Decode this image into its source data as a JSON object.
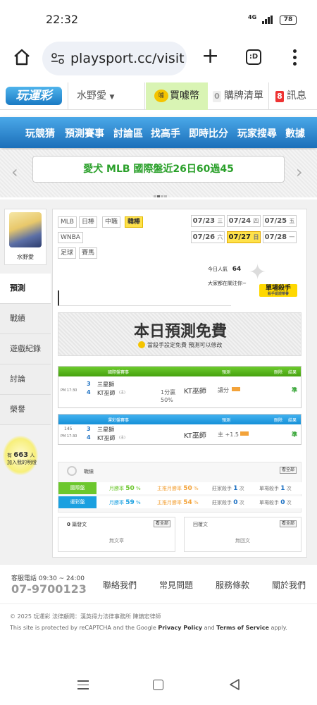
{
  "status_bar": {
    "time": "22:32",
    "signal": "4G",
    "battery": "78"
  },
  "browser": {
    "url": "playsport.cc/visit",
    "tabs_label": ":D"
  },
  "site": {
    "logo_text": "玩運彩",
    "user_name": "水野愛",
    "coin_label": "買噱幣",
    "coin_icon_text": "噱",
    "cart_count": "0",
    "cart_label": "購牌清單",
    "msg_count": "8",
    "msg_label": "訊息"
  },
  "main_nav": [
    "玩競猜",
    "預測賽事",
    "討論區",
    "找高手",
    "即時比分",
    "玩家搜尋",
    "數據"
  ],
  "banner": {
    "text": "愛犬 MLB 國際盤近26日60過45"
  },
  "sidebar": {
    "avatar_name": "水野愛",
    "items": [
      {
        "label": "預測",
        "active": true
      },
      {
        "label": "戰績"
      },
      {
        "label": "遊戲紀錄"
      },
      {
        "label": "討論"
      },
      {
        "label": "榮譽"
      }
    ],
    "bulb_count": "663",
    "bulb_prefix": "有",
    "bulb_suffix": "人",
    "bulb_line2": "加入我的明燈"
  },
  "leagues": [
    "MLB",
    "日棒",
    "中職",
    "韓棒",
    "WNBA",
    "足球",
    "賽馬"
  ],
  "active_league": "韓棒",
  "dates": [
    {
      "date": "07/23",
      "dow": "三"
    },
    {
      "date": "07/24",
      "dow": "四"
    },
    {
      "date": "07/25",
      "dow": "五"
    },
    {
      "date": "07/26",
      "dow": "六"
    },
    {
      "date": "07/27",
      "dow": "日"
    },
    {
      "date": "07/28",
      "dow": "一"
    }
  ],
  "active_date": "07/27",
  "popularity": {
    "label": "今日人氣",
    "value": "64",
    "note": "大家都在關注你~"
  },
  "sharp_badge": {
    "title": "單場殺手",
    "sub": "殺手認證榮譽"
  },
  "free_banner": {
    "title": "本日預測免費",
    "sub": "當殺手設定免費 預測可以修改"
  },
  "int_table": {
    "headers": [
      "國際盤賽事",
      "預測",
      "刪除",
      "結果"
    ],
    "row": {
      "time": "PM 17:30",
      "away_num": "3",
      "away": "三星獅",
      "home_num": "4",
      "home": "KT巫師",
      "home_tag": "(主)",
      "line1": "1分贏",
      "line2": "50%",
      "pick": "KT巫師",
      "pick_detail": "讓分",
      "result": "準"
    }
  },
  "tw_table": {
    "headers": [
      "運彩盤賽事",
      "預測",
      "刪除",
      "結果"
    ],
    "row": {
      "id": "145",
      "time": "PM 17:30",
      "away_num": "3",
      "away": "三星獅",
      "home_num": "4",
      "home": "KT巫師",
      "home_tag": "(主)",
      "pick": "KT巫師",
      "pick_detail": "主 +1.5",
      "result": "準"
    }
  },
  "stats": {
    "title": "戰績",
    "more": "看全部",
    "rows": [
      {
        "label": "國際盤",
        "win": "月勝率",
        "win_val": "50",
        "main": "主推月勝率",
        "main_val": "50",
        "killer": "莊家殺手",
        "killer_val": "1",
        "killer_unit": "次",
        "single": "單場殺手",
        "single_val": "1",
        "single_unit": "次",
        "color": "#6cc72d"
      },
      {
        "label": "運彩盤",
        "win": "月勝率",
        "win_val": "59",
        "main": "主推月勝率",
        "main_val": "54",
        "killer": "莊家殺手",
        "killer_val": "0",
        "killer_unit": "次",
        "single": "單場殺手",
        "single_val": "0",
        "single_unit": "次",
        "color": "#1aa0e0"
      }
    ]
  },
  "posts": {
    "count": "0",
    "label": "篇發文",
    "more": "看全部",
    "empty": "無文章"
  },
  "replies": {
    "label": "回覆文",
    "more": "看全部",
    "empty": "無回文"
  },
  "footer": {
    "tel_label": "客服電話 09:30 ~ 24:00",
    "tel": "07-9700123",
    "links": [
      "聯絡我們",
      "常見問題",
      "服務條款",
      "關於我們"
    ],
    "copyright": "© 2025 玩運彩 法律顧問：漢英得力法律事務所 陳鎮宏律師",
    "captcha_pre": "This site is protected by reCAPTCHA and the Google",
    "privacy": "Privacy Policy",
    "and": "and",
    "terms": "Terms of Service",
    "apply": "apply."
  }
}
